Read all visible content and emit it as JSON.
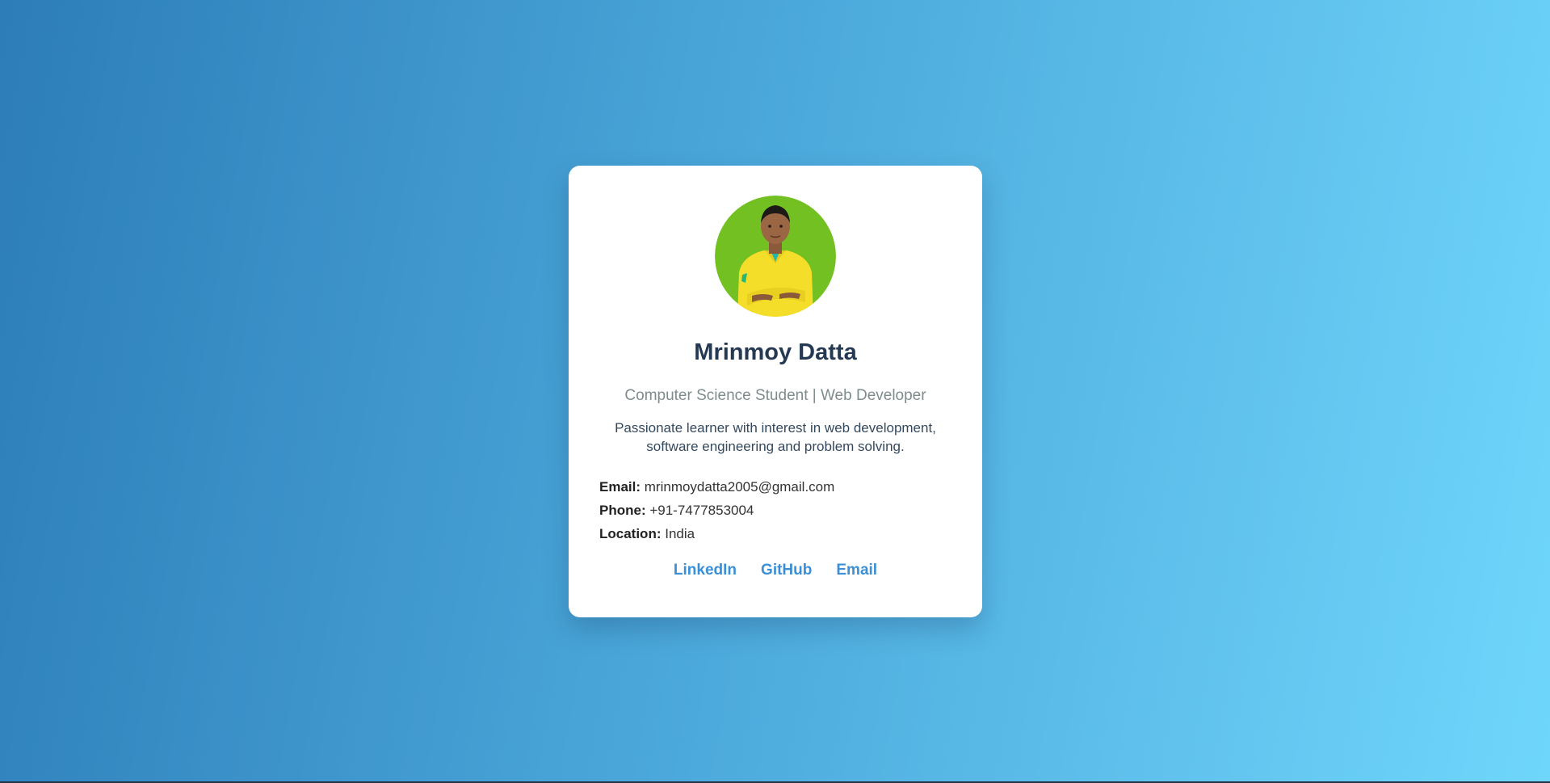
{
  "profile": {
    "name": "Mrinmoy Datta",
    "title": "Computer Science Student | Web Developer",
    "bio": "Passionate learner with interest in web development, software engineering and problem solving."
  },
  "contact": {
    "email_label": "Email:",
    "email_value": "mrinmoydatta2005@gmail.com",
    "phone_label": "Phone:",
    "phone_value": "+91-7477853004",
    "location_label": "Location:",
    "location_value": "India"
  },
  "links": {
    "linkedin": "LinkedIn",
    "github": "GitHub",
    "email": "Email"
  },
  "colors": {
    "accent": "#3a8fd6",
    "heading": "#253a52",
    "avatar_bg": "#72c021"
  }
}
